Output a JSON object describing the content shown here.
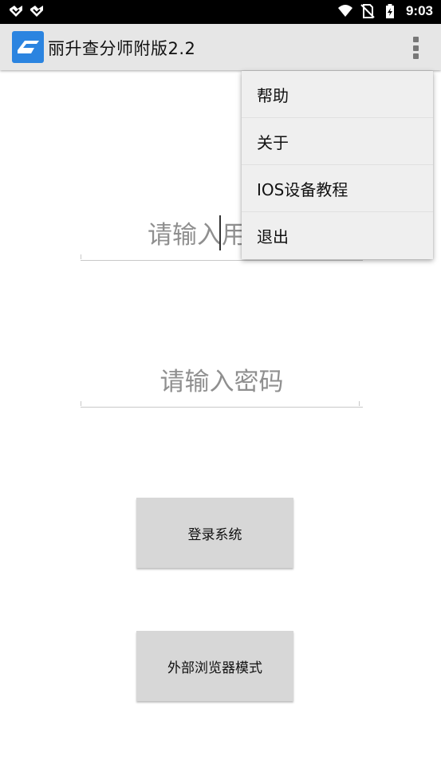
{
  "status_bar": {
    "time": "9:03",
    "left_icons": [
      "notification-icon",
      "notification-icon"
    ],
    "right_icons": [
      "wifi-icon",
      "no-sim-icon",
      "battery-charging-icon"
    ]
  },
  "app_bar": {
    "title": "丽升查分师附版2.2",
    "logo_icon": "app-logo-icon",
    "overflow_icon": "more-vert-icon"
  },
  "form": {
    "username_placeholder": "请输入用户名",
    "password_placeholder": "请输入密码"
  },
  "buttons": {
    "login_label": "登录系统",
    "browser_mode_label": "外部浏览器模式"
  },
  "menu": {
    "items": [
      {
        "label": "帮助"
      },
      {
        "label": "关于"
      },
      {
        "label": "IOS设备教程"
      },
      {
        "label": "退出"
      }
    ]
  },
  "colors": {
    "status_bar_bg": "#000000",
    "app_bar_bg": "#e6e6e6",
    "logo_bg": "#2b84e0",
    "button_bg": "#d7d7d7",
    "menu_bg": "#efefef"
  }
}
